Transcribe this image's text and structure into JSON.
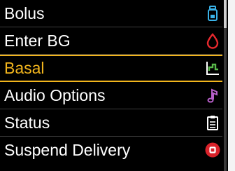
{
  "menu": {
    "items": [
      {
        "label": "Bolus",
        "icon": "bolus-cartridge-icon",
        "icon_color": "#3ab3e8"
      },
      {
        "label": "Enter BG",
        "icon": "blood-drop-icon",
        "icon_color": "#e8292e"
      },
      {
        "label": "Basal",
        "icon": "basal-profile-icon",
        "icon_color": "#59b94a",
        "selected": true
      },
      {
        "label": "Audio Options",
        "icon": "music-note-icon",
        "icon_color": "#b75fc9"
      },
      {
        "label": "Status",
        "icon": "clipboard-icon",
        "icon_color": "#ffffff"
      },
      {
        "label": "Suspend Delivery",
        "icon": "stop-icon",
        "icon_color": "#d9222a"
      }
    ]
  },
  "colors": {
    "background": "#000000",
    "highlight": "#f2b51d",
    "text": "#ffffff"
  }
}
